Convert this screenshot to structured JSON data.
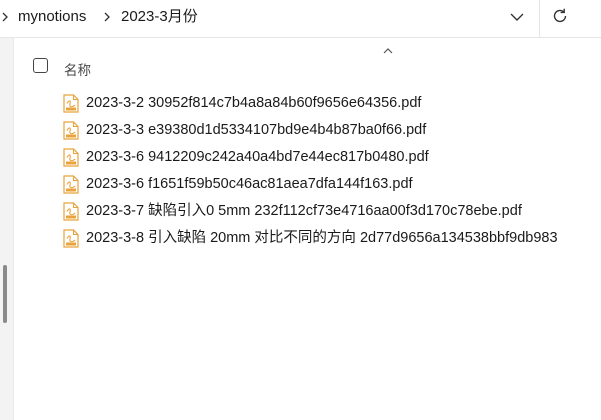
{
  "breadcrumb": {
    "items": [
      {
        "label": "mynotions"
      },
      {
        "label": "2023-3月份"
      }
    ]
  },
  "toolbar": {
    "dropdown_icon": "chevron-down-icon",
    "refresh_icon": "refresh-icon"
  },
  "header": {
    "name_column": "名称",
    "sort_icon": "chevron-up-icon"
  },
  "files": [
    {
      "name": "2023-3-2 30952f814c7b4a8a84b60f9656e64356.pdf",
      "icon": "pdf-file-icon"
    },
    {
      "name": "2023-3-3 e39380d1d5334107bd9e4b4b87ba0f66.pdf",
      "icon": "pdf-file-icon"
    },
    {
      "name": "2023-3-6 9412209c242a40a4bd7e44ec817b0480.pdf",
      "icon": "pdf-file-icon"
    },
    {
      "name": "2023-3-6 f1651f59b50c46ac81aea7dfa144f163.pdf",
      "icon": "pdf-file-icon"
    },
    {
      "name": "2023-3-7 缺陷引入0 5mm 232f112cf73e4716aa00f3d170c78ebe.pdf",
      "icon": "pdf-file-icon"
    },
    {
      "name": "2023-3-8 引入缺陷 20mm 对比不同的方向 2d77d9656a134538bbf9db983",
      "icon": "pdf-file-icon"
    }
  ],
  "colors": {
    "pdf_accent": "#e8a33c",
    "text": "#1a1a1a",
    "border": "#e5e5e5"
  }
}
